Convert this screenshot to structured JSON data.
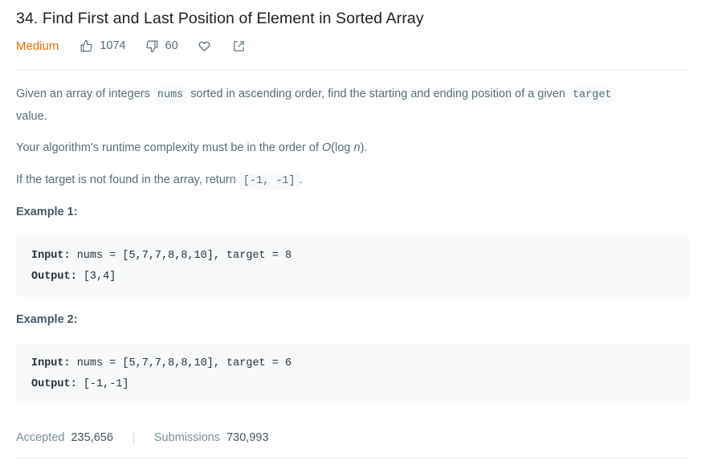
{
  "problem": {
    "title": "34. Find First and Last Position of Element in Sorted Array",
    "difficulty": "Medium",
    "likes": "1074",
    "dislikes": "60",
    "colors": {
      "difficulty": "#ef6c00",
      "text": "#546e7a",
      "code_bg": "#f7f9fa"
    }
  },
  "description": {
    "p1_a": "Given an array of integers ",
    "p1_code1": "nums",
    "p1_b": " sorted in ascending order, find the starting and ending position of a given ",
    "p1_code2": "target",
    "p1_c": "value.",
    "p2_a": "Your algorithm's runtime complexity must be in the order of ",
    "p2_b": "O",
    "p2_c": "(log ",
    "p2_d": "n",
    "p2_e": ").",
    "p3_a": "If the target is not found in the array, return ",
    "p3_code": "[-1, -1]",
    "p3_b": "."
  },
  "examples": [
    {
      "heading": "Example 1:",
      "input_label": "Input:",
      "input_value": " nums = [5,7,7,8,8,10], target = 8",
      "output_label": "Output:",
      "output_value": " [3,4]"
    },
    {
      "heading": "Example 2:",
      "input_label": "Input:",
      "input_value": " nums = [5,7,7,8,8,10], target = 6",
      "output_label": "Output:",
      "output_value": " [-1,-1]"
    }
  ],
  "stats": {
    "accepted_label": "Accepted",
    "accepted_value": "235,656",
    "submissions_label": "Submissions",
    "submissions_value": "730,993"
  },
  "icons": [
    "thumbs-up-icon",
    "thumbs-down-icon",
    "heart-icon",
    "share-icon"
  ]
}
